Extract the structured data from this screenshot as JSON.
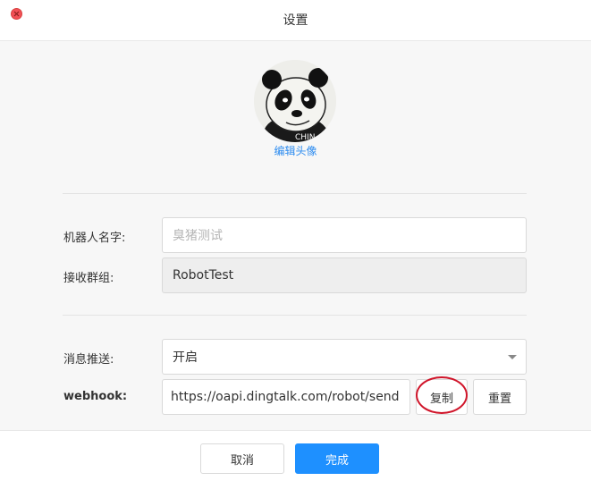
{
  "window": {
    "title": "设置"
  },
  "avatar": {
    "edit_label": "编辑头像",
    "image_text": "CHIN"
  },
  "form": {
    "robot_name": {
      "label": "机器人名字:",
      "placeholder": "臭猪测试"
    },
    "receive_group": {
      "label": "接收群组:",
      "value": "RobotTest"
    },
    "push": {
      "label": "消息推送:",
      "value": "开启"
    },
    "webhook": {
      "label": "webhook:",
      "value": "https://oapi.dingtalk.com/robot/send",
      "copy_label": "复制",
      "reset_label": "重置"
    }
  },
  "footer": {
    "cancel_label": "取消",
    "done_label": "完成"
  },
  "colors": {
    "primary": "#1e90ff",
    "link": "#2d8cf0",
    "close": "#f25056",
    "annotation": "#d0152a"
  },
  "icons": {
    "close": "close-icon",
    "dropdown": "chevron-down-icon"
  }
}
